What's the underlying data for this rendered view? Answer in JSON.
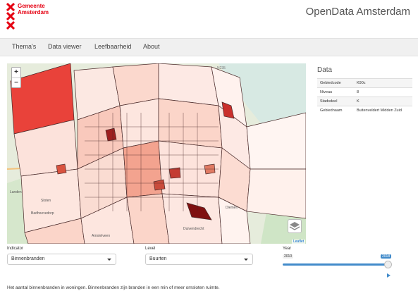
{
  "header": {
    "logo_text_line1": "Gemeente",
    "logo_text_line2": "Amsterdam",
    "site_title": "OpenData Amsterdam"
  },
  "nav": {
    "items": [
      {
        "label": "Thema's"
      },
      {
        "label": "Data viewer"
      },
      {
        "label": "Leefbaarheid"
      },
      {
        "label": "About"
      }
    ]
  },
  "map": {
    "zoom_in": "+",
    "zoom_out": "−",
    "attribution": "Leaflet",
    "place_labels": [
      "Sloten",
      "Badhoevedorp",
      "Amstelveen",
      "Duivendrecht",
      "Diemen",
      "Landen"
    ],
    "road_label": "N235"
  },
  "data_panel": {
    "title": "Data",
    "rows": [
      {
        "key": "Gebiedcode",
        "value": "K90c"
      },
      {
        "key": "Niveau",
        "value": "8"
      },
      {
        "key": "Stadsdeel",
        "value": "K"
      },
      {
        "key": "Gebiednaam",
        "value": "Buitenveldert Midden Zuid"
      }
    ]
  },
  "controls": {
    "indicator_label": "Indicator",
    "indicator_value": "Binnenbranden",
    "level_label": "Level",
    "level_value": "Buurten",
    "year_label": "Year",
    "year_min": "2010",
    "year_value": "2018",
    "year_fraction": 1.0
  },
  "description": "Het aantal binnenbranden in woningen. Binnenbranden zijn branden in een min of meer omsloten ruimte.",
  "colors": {
    "brand_red": "#e50012",
    "slider_blue": "#428bca"
  }
}
